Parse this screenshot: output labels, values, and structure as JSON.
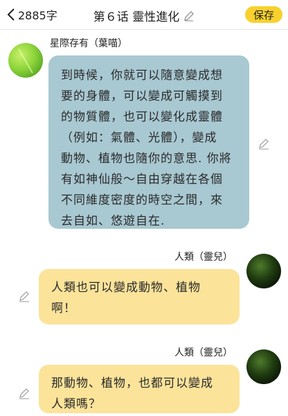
{
  "header": {
    "back_icon": "chevron-left-icon",
    "word_count": "2885字",
    "title": "第６话 靈性進化",
    "edit_icon": "pencil-icon",
    "save_label": "保存",
    "accent_color": "#f8d12e"
  },
  "messages": [
    {
      "side": "left",
      "sender": "星際存有（葉喵）",
      "bubble_color": "#a8c8d2",
      "lines": [
        "到時候，你就可以隨意變成想",
        "要的身體，可以變成可觸摸到",
        "的物質體，也可以變化成靈體",
        "（例如：氣體、光體），變成",
        "動物、植物也隨你的意思. 你將",
        "有如神仙般～自由穿越在各個",
        "不同維度密度的時空之間，來",
        "去自如、悠遊自在."
      ]
    },
    {
      "side": "right",
      "sender": "人類（靈兒）",
      "bubble_color": "#fbe39a",
      "lines": [
        "人類也可以變成動物、植物",
        "啊！"
      ]
    },
    {
      "side": "right",
      "sender": "人類（靈兒）",
      "bubble_color": "#fbe39a",
      "lines": [
        "那動物、植物，也都可以變成",
        "人類嗎？"
      ]
    }
  ]
}
